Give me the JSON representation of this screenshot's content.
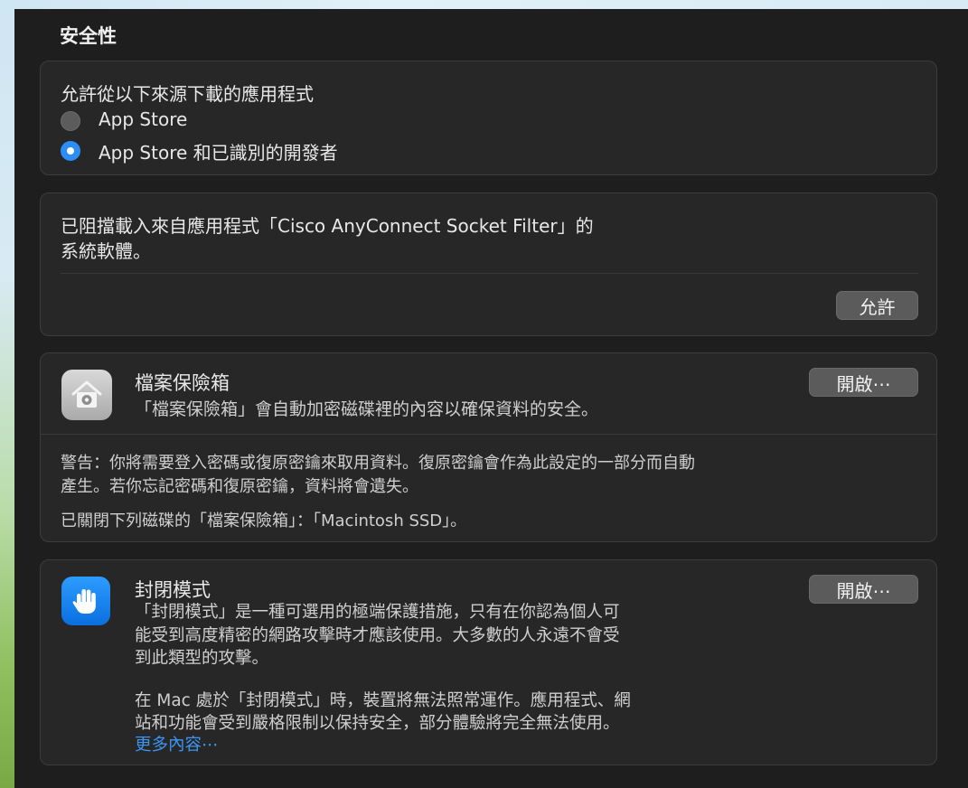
{
  "security": {
    "title": "安全性",
    "downloads": {
      "heading": "允許從以下來源下載的應用程式",
      "options": [
        {
          "label": "App Store",
          "selected": false
        },
        {
          "label": "App Store 和已識別的開發者",
          "selected": true
        }
      ]
    },
    "blocked": {
      "line1": "已阻擋載入來自應用程式「Cisco AnyConnect Socket Filter」的",
      "line2": "系統軟體。",
      "allow_button": "允許"
    },
    "filevault": {
      "title": "檔案保險箱",
      "description": "「檔案保險箱」會自動加密磁碟裡的內容以確保資料的安全。",
      "button": "開啟⋯",
      "warning_line1": "警告：你將需要登入密碼或復原密鑰來取用資料。復原密鑰會作為此設定的一部分而自動",
      "warning_line2": "產生。若你忘記密碼和復原密鑰，資料將會遺失。",
      "status": "已關閉下列磁碟的「檔案保險箱」：「Macintosh SSD」。"
    },
    "lockdown": {
      "title": "封閉模式",
      "button": "開啟⋯",
      "desc_line1": "「封閉模式」是一種可選用的極端保護措施，只有在你認為個人可",
      "desc_line2": "能受到高度精密的網路攻擊時才應該使用。大多數的人永遠不會受",
      "desc_line3": "到此類型的攻擊。",
      "desc2_line1": "在 Mac 處於「封閉模式」時，裝置將無法照常運作。應用程式、網",
      "desc2_line2": "站和功能會受到嚴格限制以保持安全，部分體驗將完全無法使用。",
      "more_link": "更多內容⋯"
    }
  },
  "colors": {
    "accent": "#2c8ef5",
    "link": "#3b95f5",
    "card": "#272727",
    "background": "#1e1e1e"
  },
  "icons": {
    "filevault": "house-safe-icon",
    "lockdown": "raised-hand-icon"
  }
}
